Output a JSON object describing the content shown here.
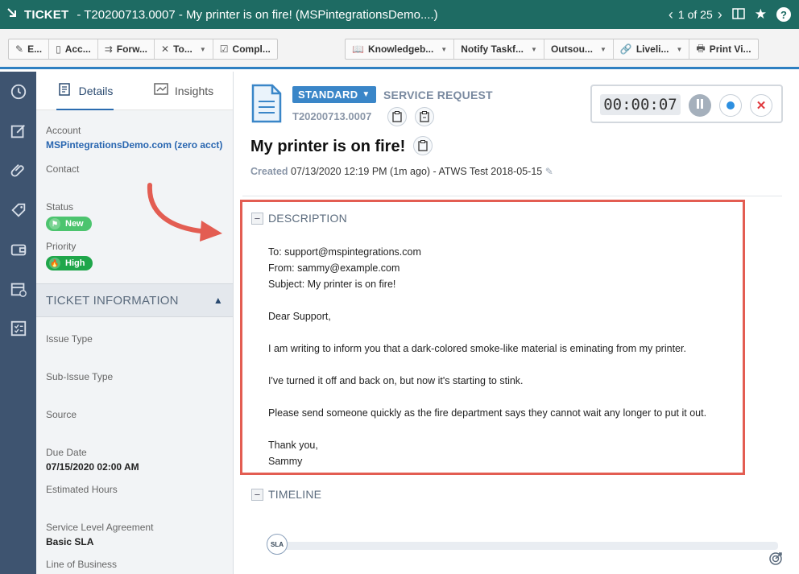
{
  "titlebar": {
    "label": "TICKET",
    "title": "- T20200713.0007 - My printer is on fire! (MSPintegrationsDemo....)",
    "pager": "1 of 25"
  },
  "toolbar": {
    "group1": [
      {
        "icon": "pencil-icon",
        "label": "E..."
      },
      {
        "icon": "document-icon",
        "label": "Acc..."
      },
      {
        "icon": "forward-icon",
        "label": "Forw..."
      },
      {
        "icon": "tools-icon",
        "label": "To..."
      },
      {
        "icon": "checkbox-icon",
        "label": "Compl..."
      }
    ],
    "group2": [
      {
        "icon": "book-icon",
        "label": "Knowledgeb..."
      },
      {
        "icon": "",
        "label": "Notify Taskf..."
      },
      {
        "icon": "",
        "label": "Outsou..."
      },
      {
        "icon": "link-icon",
        "label": "Liveli..."
      },
      {
        "icon": "printer-icon",
        "label": "Print Vi..."
      }
    ]
  },
  "left_tabs": {
    "details": "Details",
    "insights": "Insights"
  },
  "fields": {
    "account_label": "Account",
    "account_value": "MSPintegrationsDemo.com (zero acct)",
    "contact_label": "Contact",
    "status_label": "Status",
    "status_value": "New",
    "priority_label": "Priority",
    "priority_value": "High"
  },
  "ticket_info": {
    "header": "TICKET INFORMATION",
    "issue_type_label": "Issue Type",
    "sub_issue_type_label": "Sub-Issue Type",
    "source_label": "Source",
    "due_date_label": "Due Date",
    "due_date_value": "07/15/2020 02:00 AM",
    "estimated_hours_label": "Estimated Hours",
    "sla_label": "Service Level Agreement",
    "sla_value": "Basic SLA",
    "lob_label": "Line of Business"
  },
  "ticket": {
    "badge": "STANDARD",
    "type": "SERVICE REQUEST",
    "number": "T20200713.0007",
    "title": "My printer is on fire!",
    "created_label": "Created",
    "created_value": "07/13/2020 12:19 PM (1m ago) - ATWS Test 2018-05-15"
  },
  "timer": {
    "value": "00:00:07"
  },
  "description": {
    "header": "DESCRIPTION",
    "lines": {
      "to": "To: support@mspintegrations.com",
      "from": "From: sammy@example.com",
      "subject": "Subject: My printer is on fire!",
      "greeting": "Dear Support,",
      "p1": "I am writing to inform you that a dark-colored smoke-like material is eminating from my printer.",
      "p2": "I've turned it off and back on, but now it's starting to stink.",
      "p3": "Please send someone quickly as the fire department says they cannot wait any longer to put it out.",
      "closing": "Thank you,",
      "signature": "Sammy"
    }
  },
  "timeline": {
    "header": "TIMELINE",
    "marker": "SLA"
  },
  "colors": {
    "titlebar": "#1e6b63",
    "accent": "#2d7fc1",
    "rail": "#3e5470",
    "highlight": "#e35d52",
    "status_new": "#4cc46e",
    "priority_high": "#1fa64a"
  }
}
